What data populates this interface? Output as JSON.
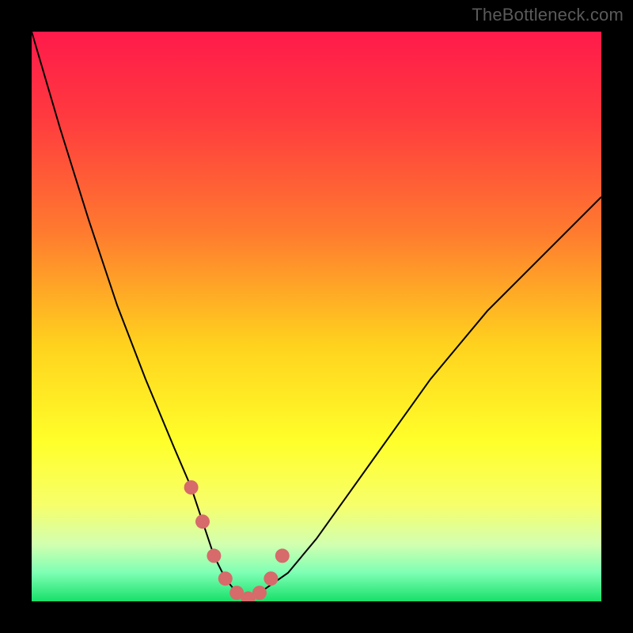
{
  "attribution": "TheBottleneck.com",
  "chart_data": {
    "type": "line",
    "title": "",
    "xlabel": "",
    "ylabel": "",
    "xlim": [
      0,
      100
    ],
    "ylim": [
      0,
      100
    ],
    "grid": false,
    "legend": false,
    "series": [
      {
        "name": "bottleneck-curve",
        "color": "#000000",
        "x": [
          0,
          5,
          10,
          15,
          20,
          25,
          28,
          30,
          32,
          34,
          36,
          38,
          40,
          45,
          50,
          55,
          60,
          65,
          70,
          75,
          80,
          85,
          90,
          95,
          100
        ],
        "values": [
          100,
          83,
          67,
          52,
          39,
          27,
          20,
          14,
          8,
          4,
          1.5,
          0.5,
          1.5,
          5,
          11,
          18,
          25,
          32,
          39,
          45,
          51,
          56,
          61,
          66,
          71
        ]
      },
      {
        "name": "optimal-zone-highlight",
        "color": "#d76a6a",
        "x": [
          28,
          30,
          32,
          34,
          36,
          38,
          40,
          42,
          44
        ],
        "values": [
          20,
          14,
          8,
          4,
          1.5,
          0.5,
          1.5,
          4,
          8
        ]
      }
    ],
    "background_gradient": {
      "stops": [
        {
          "offset": 0.0,
          "color": "#ff1a4b"
        },
        {
          "offset": 0.15,
          "color": "#ff3a3f"
        },
        {
          "offset": 0.35,
          "color": "#ff7a2f"
        },
        {
          "offset": 0.55,
          "color": "#ffd21e"
        },
        {
          "offset": 0.72,
          "color": "#ffff2a"
        },
        {
          "offset": 0.83,
          "color": "#f7ff6a"
        },
        {
          "offset": 0.9,
          "color": "#d2ffb0"
        },
        {
          "offset": 0.95,
          "color": "#7dffb4"
        },
        {
          "offset": 1.0,
          "color": "#18e06a"
        }
      ]
    }
  }
}
